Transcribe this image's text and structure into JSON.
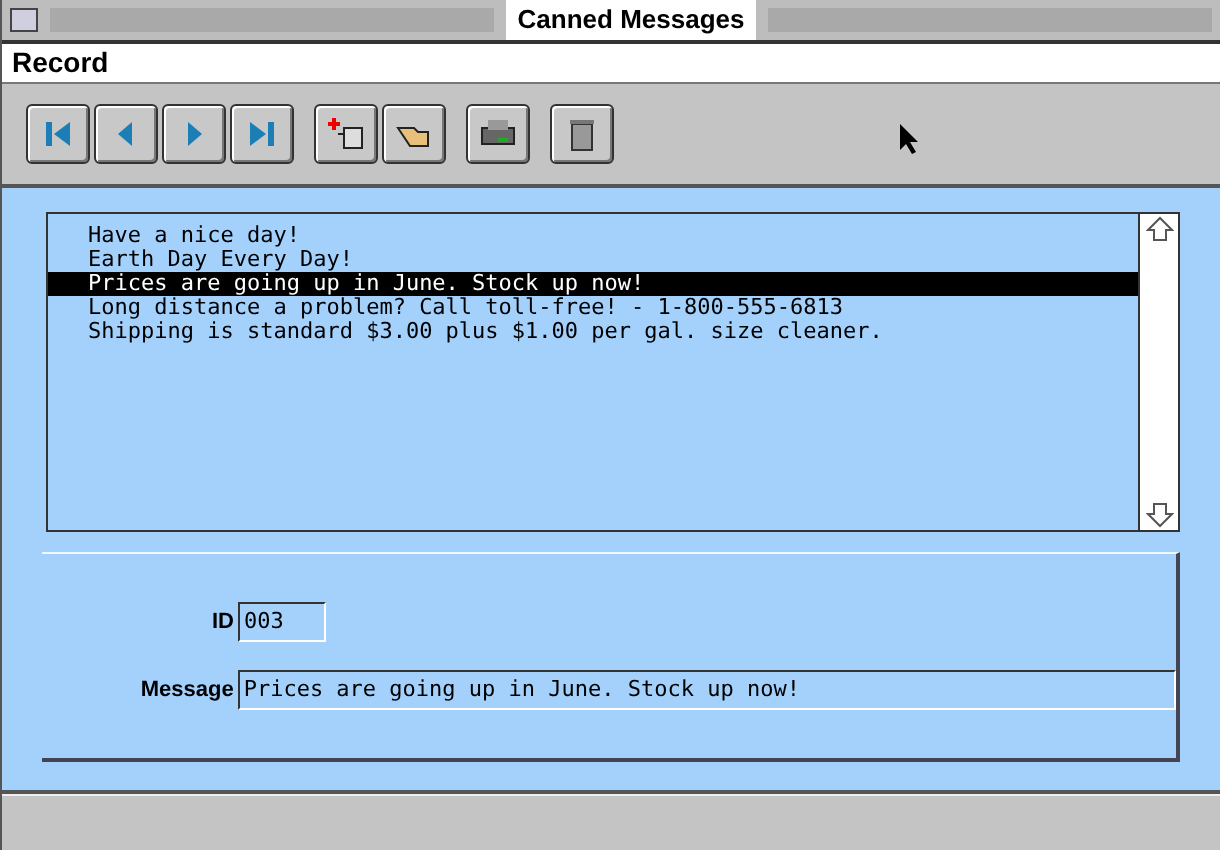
{
  "window": {
    "title": "Canned Messages"
  },
  "menu": [
    "Record"
  ],
  "list": {
    "rows": [
      {
        "text": "Have a nice day!",
        "selected": false
      },
      {
        "text": "Earth Day Every Day!",
        "selected": false
      },
      {
        "text": "Prices are going up in June. Stock up now!",
        "selected": true
      },
      {
        "text": "Long distance a problem? Call toll-free! - 1-800-555-6813",
        "selected": false
      },
      {
        "text": "Shipping is standard $3.00 plus $1.00 per gal. size cleaner.",
        "selected": false
      }
    ]
  },
  "form": {
    "fields": [
      {
        "label": "ID",
        "value": "003",
        "kind": "short"
      },
      {
        "label": "Message",
        "value": "Prices are going up in June. Stock up now!",
        "kind": "long"
      }
    ]
  }
}
